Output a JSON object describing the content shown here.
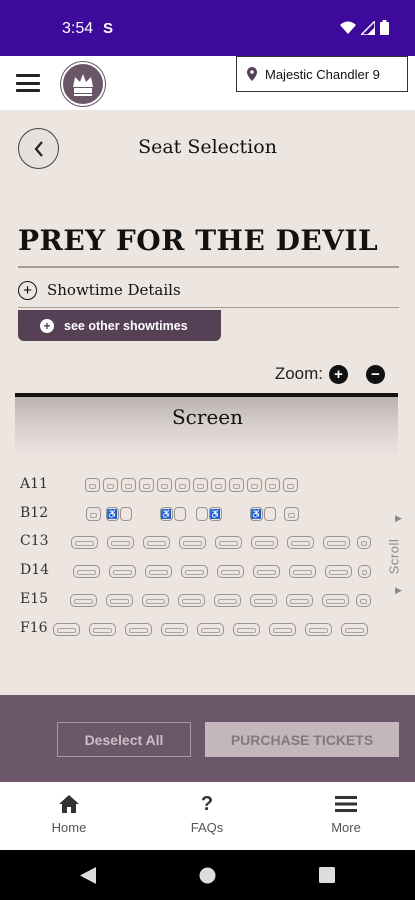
{
  "status_bar": {
    "time": "3:54",
    "notification_icon": "S"
  },
  "header": {
    "menu_icon": "hamburger-icon",
    "logo_icon": "crown-icon",
    "location_icon": "pin-icon",
    "location": "Majestic Chandler 9"
  },
  "page": {
    "title": "Seat Selection",
    "movie_title": "PREY FOR THE DEVIL",
    "showtime_details": "Showtime Details",
    "other_showtimes": "see other showtimes",
    "zoom_label": "Zoom:",
    "screen_label": "Screen",
    "scroll_label": "Scroll"
  },
  "seat_rows": [
    {
      "label": "A11",
      "seat_count": 12
    },
    {
      "label": "B12",
      "seat_count": 10,
      "accessible_seats": 4
    },
    {
      "label": "C13",
      "seat_count": 9
    },
    {
      "label": "D14",
      "seat_count": 9
    },
    {
      "label": "E15",
      "seat_count": 9
    },
    {
      "label": "F16",
      "seat_count": 9
    }
  ],
  "actions": {
    "deselect": "Deselect All",
    "purchase": "PURCHASE TICKETS"
  },
  "bottom_nav": [
    {
      "label": "Home",
      "icon": "home-icon"
    },
    {
      "label": "FAQs",
      "icon": "question-icon"
    },
    {
      "label": "More",
      "icon": "menu-icon"
    }
  ],
  "colors": {
    "status_bar": "#3d0a9c",
    "accent": "#564056",
    "action_bar": "#6c566a",
    "background": "#ede5e0"
  }
}
